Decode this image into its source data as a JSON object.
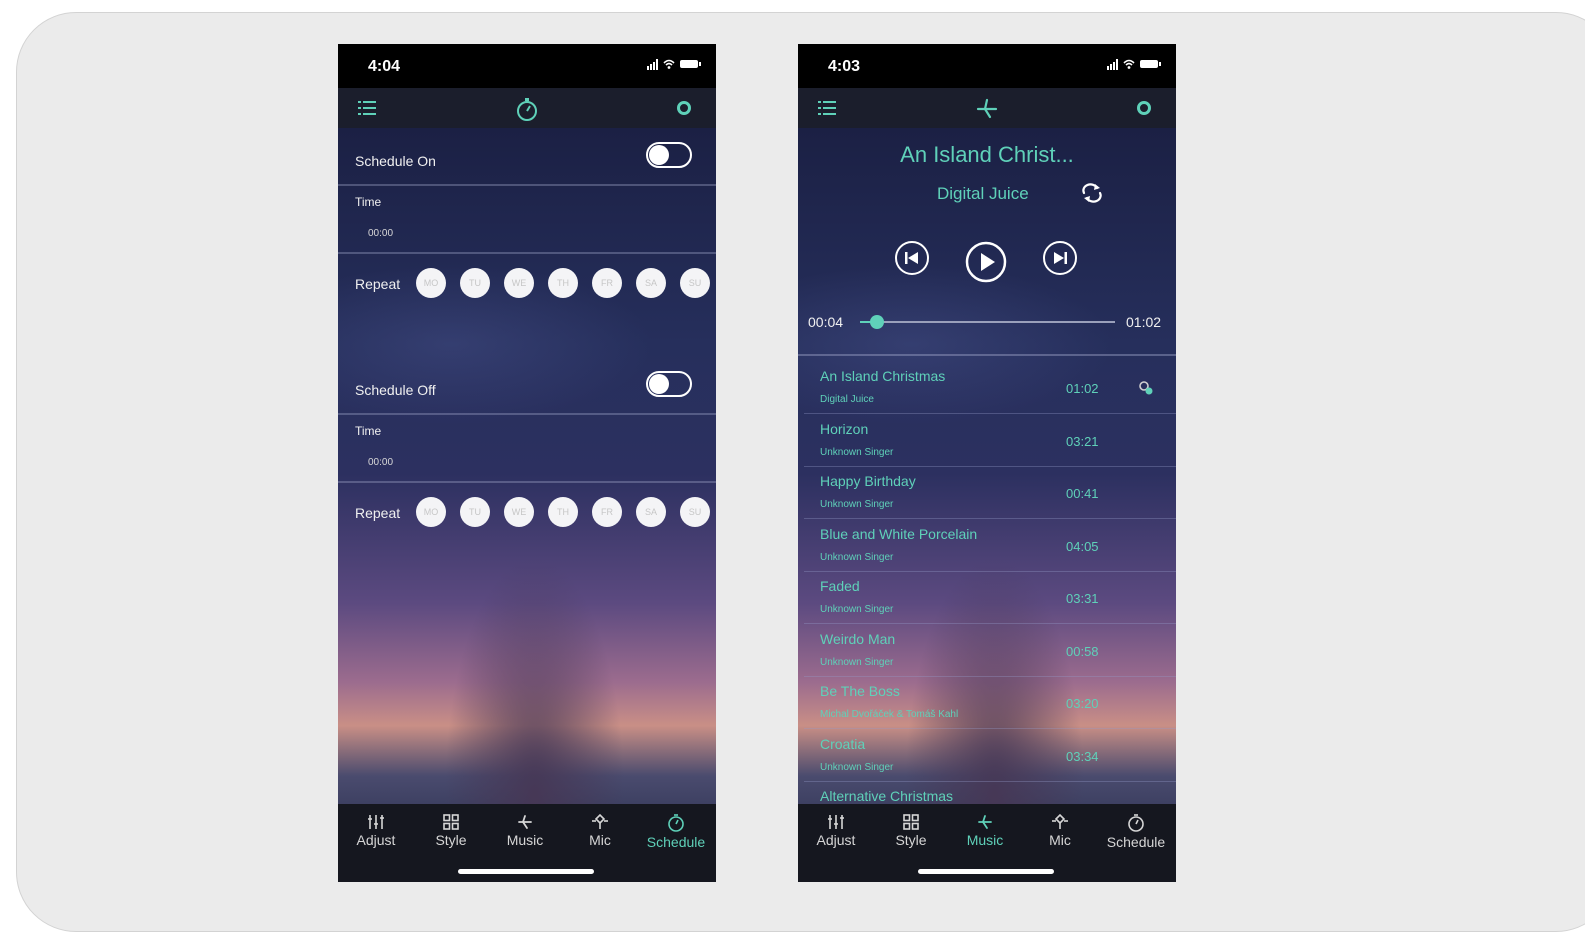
{
  "colors": {
    "accent": "#5fd1b9",
    "tabbar": "#15171f",
    "topbar": "#1b1e2c"
  },
  "schedule_screen": {
    "status_time": "4:04",
    "top_icons": [
      "list-icon",
      "stopwatch-icon",
      "gear-icon"
    ],
    "schedule_on": {
      "label": "Schedule On",
      "enabled": false,
      "time_label": "Time",
      "time_value": "00:00",
      "repeat_label": "Repeat",
      "days": [
        "MO",
        "TU",
        "WE",
        "TH",
        "FR",
        "SA",
        "SU"
      ]
    },
    "schedule_off": {
      "label": "Schedule Off",
      "enabled": false,
      "time_label": "Time",
      "time_value": "00:00",
      "repeat_label": "Repeat",
      "days": [
        "MO",
        "TU",
        "WE",
        "TH",
        "FR",
        "SA",
        "SU"
      ]
    }
  },
  "music_screen": {
    "status_time": "4:03",
    "top_icons": [
      "list-icon",
      "music-icon",
      "gear-icon"
    ],
    "now_playing": {
      "title": "An Island Christ...",
      "artist": "Digital Juice",
      "elapsed": "00:04",
      "duration": "01:02",
      "progress": 0.065
    },
    "songs": [
      {
        "title": "An Island Christmas",
        "artist": "Digital Juice",
        "duration": "01:02"
      },
      {
        "title": "Horizon",
        "artist": "Unknown Singer",
        "duration": "03:21"
      },
      {
        "title": "Happy Birthday",
        "artist": "Unknown Singer",
        "duration": "00:41"
      },
      {
        "title": "Blue and White Porcelain",
        "artist": "Unknown Singer",
        "duration": "04:05"
      },
      {
        "title": "Faded",
        "artist": "Unknown Singer",
        "duration": "03:31"
      },
      {
        "title": "Weirdo Man",
        "artist": "Unknown Singer",
        "duration": "00:58"
      },
      {
        "title": "Be The Boss",
        "artist": "Michal Dvořáček & Tomáš Kahl",
        "duration": "03:20"
      },
      {
        "title": "Croatia",
        "artist": "Unknown Singer",
        "duration": "03:34"
      },
      {
        "title": "Alternative Christmas",
        "artist": "",
        "duration": ""
      }
    ]
  },
  "tabs": [
    "Adjust",
    "Style",
    "Music",
    "Mic",
    "Schedule"
  ],
  "tab_icons": [
    "sliders-icon",
    "grid-icon",
    "music-icon",
    "mic-icon",
    "stopwatch-icon"
  ],
  "active_tabs": {
    "left": "Schedule",
    "right": "Music"
  }
}
